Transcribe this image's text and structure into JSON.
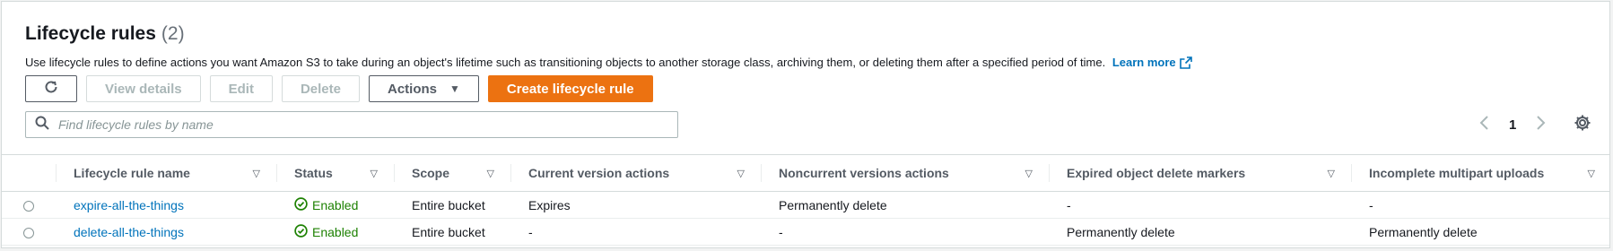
{
  "header": {
    "title": "Lifecycle rules",
    "count": "(2)",
    "description": "Use lifecycle rules to define actions you want Amazon S3 to take during an object's lifetime such as transitioning objects to another storage class, archiving them, or deleting them after a specified period of time.",
    "learn_more": "Learn more"
  },
  "toolbar": {
    "view_details": "View details",
    "edit": "Edit",
    "delete": "Delete",
    "actions": "Actions",
    "create": "Create lifecycle rule"
  },
  "search": {
    "placeholder": "Find lifecycle rules by name"
  },
  "pagination": {
    "current_page": "1"
  },
  "table": {
    "columns": [
      "Lifecycle rule name",
      "Status",
      "Scope",
      "Current version actions",
      "Noncurrent versions actions",
      "Expired object delete markers",
      "Incomplete multipart uploads"
    ],
    "rows": [
      {
        "name": "expire-all-the-things",
        "status": "Enabled",
        "scope": "Entire bucket",
        "current": "Expires",
        "noncurrent": "Permanently delete",
        "expired": "-",
        "multipart": "-"
      },
      {
        "name": "delete-all-the-things",
        "status": "Enabled",
        "scope": "Entire bucket",
        "current": "-",
        "noncurrent": "-",
        "expired": "Permanently delete",
        "multipart": "Permanently delete"
      }
    ]
  },
  "colors": {
    "primary": "#ec7211",
    "link": "#0073bb",
    "success": "#1d8102"
  },
  "icons": [
    "refresh-icon",
    "external-link-icon",
    "caret-down-icon",
    "search-icon",
    "chevron-left-icon",
    "chevron-right-icon",
    "settings-icon",
    "sort-icon",
    "check-circle-icon"
  ]
}
